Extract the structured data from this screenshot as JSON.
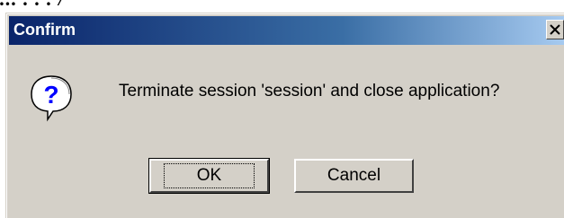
{
  "background": {
    "partial_text": "... . . . /"
  },
  "dialog": {
    "title": "Confirm",
    "close_glyph": "×",
    "icon": "question-icon",
    "message": "Terminate session 'session' and close application?",
    "buttons": {
      "ok": "OK",
      "cancel": "Cancel"
    }
  },
  "colors": {
    "face": "#d4d0c8",
    "title_start": "#0a246a",
    "title_end": "#a6caf0",
    "icon_blue": "#0000ff"
  }
}
